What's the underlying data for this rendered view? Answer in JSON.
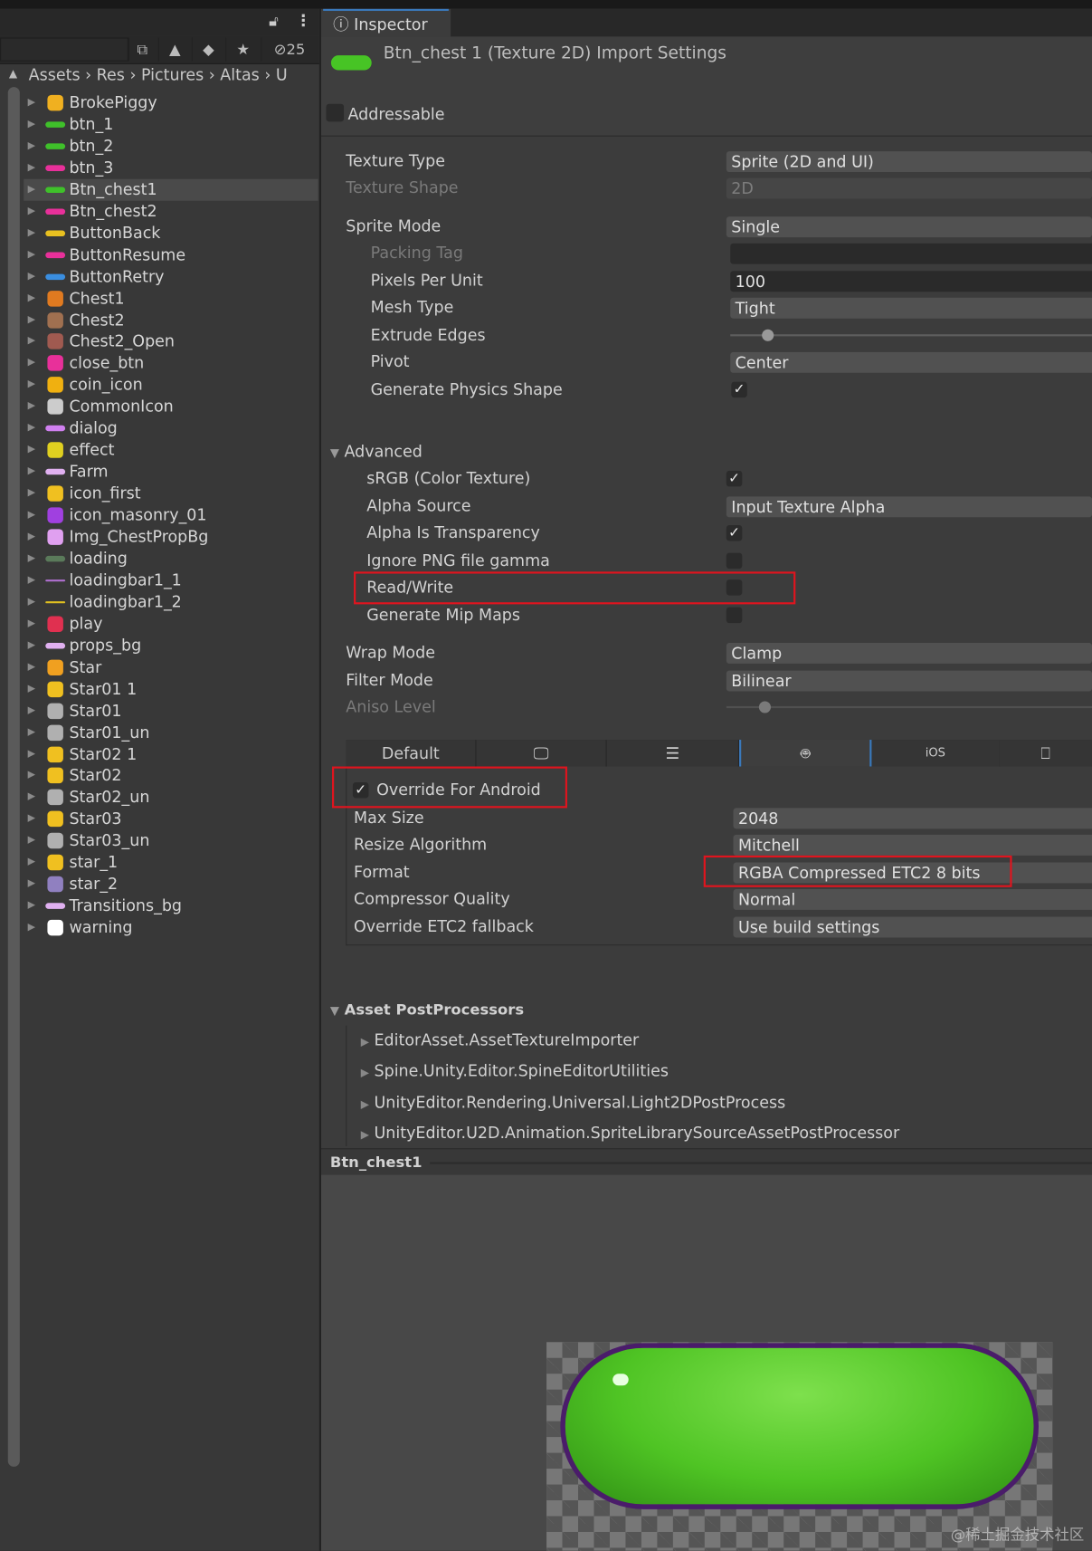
{
  "project": {
    "hidden_count": "25",
    "breadcrumb": [
      "Assets",
      "Res",
      "Pictures",
      "Altas",
      "U"
    ],
    "items": [
      {
        "label": "BrokePiggy",
        "color": "#f0b020"
      },
      {
        "label": "btn_1",
        "color": "#3fc02a"
      },
      {
        "label": "btn_2",
        "color": "#3fc02a"
      },
      {
        "label": "btn_3",
        "color": "#e8309a"
      },
      {
        "label": "Btn_chest1",
        "color": "#3fc02a",
        "selected": true
      },
      {
        "label": "Btn_chest2",
        "color": "#e8309a"
      },
      {
        "label": "ButtonBack",
        "color": "#e8c020"
      },
      {
        "label": "ButtonResume",
        "color": "#e8309a"
      },
      {
        "label": "ButtonRetry",
        "color": "#3a8ee0"
      },
      {
        "label": "Chest1",
        "color": "#e07a20"
      },
      {
        "label": "Chest2",
        "color": "#a07050"
      },
      {
        "label": "Chest2_Open",
        "color": "#a05a50"
      },
      {
        "label": "close_btn",
        "color": "#e8309a"
      },
      {
        "label": "coin_icon",
        "color": "#f0b010"
      },
      {
        "label": "CommonIcon",
        "color": "#cccccc"
      },
      {
        "label": "dialog",
        "color": "#d080f0"
      },
      {
        "label": "effect",
        "color": "#e0d020"
      },
      {
        "label": "Farm",
        "color": "#e0b0f0"
      },
      {
        "label": "icon_first",
        "color": "#f0c020"
      },
      {
        "label": "icon_masonry_01",
        "color": "#a040e0"
      },
      {
        "label": "Img_ChestPropBg",
        "color": "#e0a0f0"
      },
      {
        "label": "loading",
        "color": "#5a7a5a"
      },
      {
        "label": "loadingbar1_1",
        "color": "#b070d0"
      },
      {
        "label": "loadingbar1_2",
        "color": "#e0c020"
      },
      {
        "label": "play",
        "color": "#e03050"
      },
      {
        "label": "props_bg",
        "color": "#e0b0f0"
      },
      {
        "label": "Star",
        "color": "#f0a020"
      },
      {
        "label": "Star01 1",
        "color": "#f0c020"
      },
      {
        "label": "Star01",
        "color": "#b0b0b0"
      },
      {
        "label": "Star01_un",
        "color": "#b0b0b0"
      },
      {
        "label": "Star02 1",
        "color": "#f0c020"
      },
      {
        "label": "Star02",
        "color": "#f0c020"
      },
      {
        "label": "Star02_un",
        "color": "#b0b0b0"
      },
      {
        "label": "Star03",
        "color": "#f0c020"
      },
      {
        "label": "Star03_un",
        "color": "#b0b0b0"
      },
      {
        "label": "star_1",
        "color": "#f0c020"
      },
      {
        "label": "star_2",
        "color": "#9080c0"
      },
      {
        "label": "Transitions_bg",
        "color": "#e0b0f0"
      },
      {
        "label": "warning",
        "color": "#ffffff"
      }
    ]
  },
  "inspector": {
    "tab": "Inspector",
    "title": "Btn_chest 1 (Texture 2D) Import Settings",
    "addressable": "Addressable",
    "texture_type": {
      "label": "Texture Type",
      "value": "Sprite (2D and UI)"
    },
    "texture_shape": {
      "label": "Texture Shape",
      "value": "2D"
    },
    "sprite_mode": {
      "label": "Sprite Mode",
      "value": "Single"
    },
    "packing_tag": {
      "label": "Packing Tag",
      "value": ""
    },
    "pixels_per_unit": {
      "label": "Pixels Per Unit",
      "value": "100"
    },
    "mesh_type": {
      "label": "Mesh Type",
      "value": "Tight"
    },
    "extrude_edges": {
      "label": "Extrude Edges",
      "value": 0.05
    },
    "pivot": {
      "label": "Pivot",
      "value": "Center"
    },
    "physics_shape": {
      "label": "Generate Physics Shape",
      "checked": true
    },
    "advanced": "Advanced",
    "srgb": {
      "label": "sRGB (Color Texture)",
      "checked": true
    },
    "alpha_source": {
      "label": "Alpha Source",
      "value": "Input Texture Alpha"
    },
    "alpha_transparency": {
      "label": "Alpha Is Transparency",
      "checked": true
    },
    "ignore_png": {
      "label": "Ignore PNG file gamma",
      "checked": false
    },
    "read_write": {
      "label": "Read/Write",
      "checked": false
    },
    "mipmaps": {
      "label": "Generate Mip Maps",
      "checked": false
    },
    "wrap_mode": {
      "label": "Wrap Mode",
      "value": "Clamp"
    },
    "filter_mode": {
      "label": "Filter Mode",
      "value": "Bilinear"
    },
    "aniso_level": {
      "label": "Aniso Level",
      "value": 0.1
    },
    "platform_tabs": [
      "Default",
      "monitor",
      "server",
      "android",
      "iOS",
      "html5"
    ],
    "override": {
      "label": "Override For Android",
      "checked": true
    },
    "max_size": {
      "label": "Max Size",
      "value": "2048"
    },
    "resize": {
      "label": "Resize Algorithm",
      "value": "Mitchell"
    },
    "format": {
      "label": "Format",
      "value": "RGBA Compressed ETC2 8 bits"
    },
    "compressor": {
      "label": "Compressor Quality",
      "value": "Normal"
    },
    "etc2_fallback": {
      "label": "Override ETC2 fallback",
      "value": "Use build settings"
    },
    "postprocessors": {
      "label": "Asset PostProcessors",
      "items": [
        "EditorAsset.AssetTextureImporter",
        "Spine.Unity.Editor.SpineEditorUtilities",
        "UnityEditor.Rendering.Universal.Light2DPostProcess",
        "UnityEditor.U2D.Animation.SpriteLibrarySourceAssetPostProcessor"
      ]
    },
    "preview_title": "Btn_chest1"
  },
  "watermark": "@稀土掘金技术社区",
  "colors": {
    "highlight": "#e0141e",
    "accent": "#3a79bb"
  }
}
